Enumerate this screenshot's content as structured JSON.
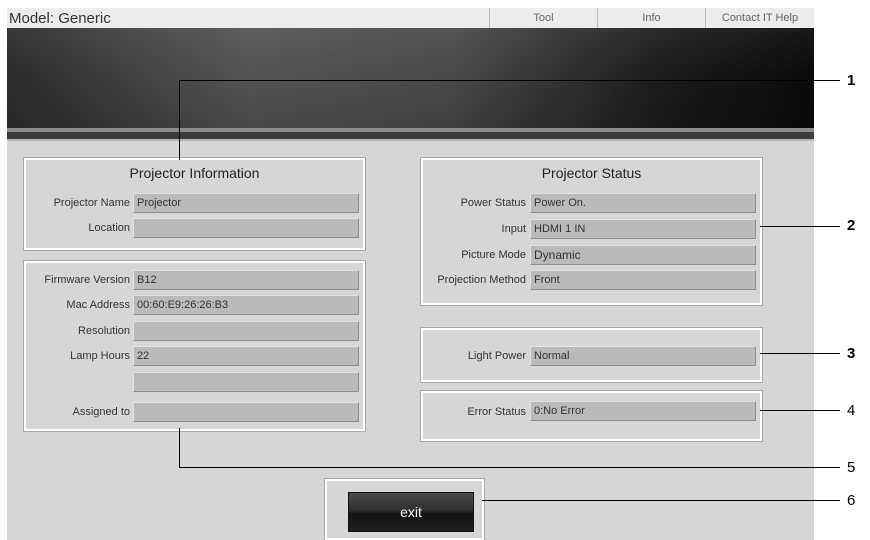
{
  "header": {
    "model_title": "Model: Generic",
    "menu": [
      "Tool",
      "Info",
      "Contact IT Help"
    ]
  },
  "projector_information": {
    "title": "Projector Information",
    "rows": [
      {
        "label": "Projector Name",
        "value": "Projector"
      },
      {
        "label": "Location",
        "value": ""
      }
    ]
  },
  "details": {
    "rows": [
      {
        "label": "Firmware Version",
        "value": "B12"
      },
      {
        "label": "Mac Address",
        "value": "00:60:E9:26:26:B3"
      },
      {
        "label": "Resolution",
        "value": ""
      },
      {
        "label": "Lamp Hours",
        "value": "22"
      },
      {
        "label": "",
        "value": ""
      },
      {
        "label": "Assigned to",
        "value": ""
      }
    ]
  },
  "projector_status": {
    "title": "Projector Status",
    "rows": [
      {
        "label": "Power Status",
        "value": "Power On."
      },
      {
        "label": "Input",
        "value": "HDMI 1 IN"
      },
      {
        "label": "Picture Mode",
        "value": "Dynamic"
      },
      {
        "label": "Projection Method",
        "value": "Front"
      }
    ]
  },
  "light_power": {
    "label": "Light Power",
    "value": "Normal"
  },
  "error_status": {
    "label": "Error Status",
    "value": "0:No Error"
  },
  "exit_button": {
    "label": "exit"
  },
  "callouts": [
    "1",
    "2",
    "3",
    "4",
    "5",
    "6"
  ]
}
